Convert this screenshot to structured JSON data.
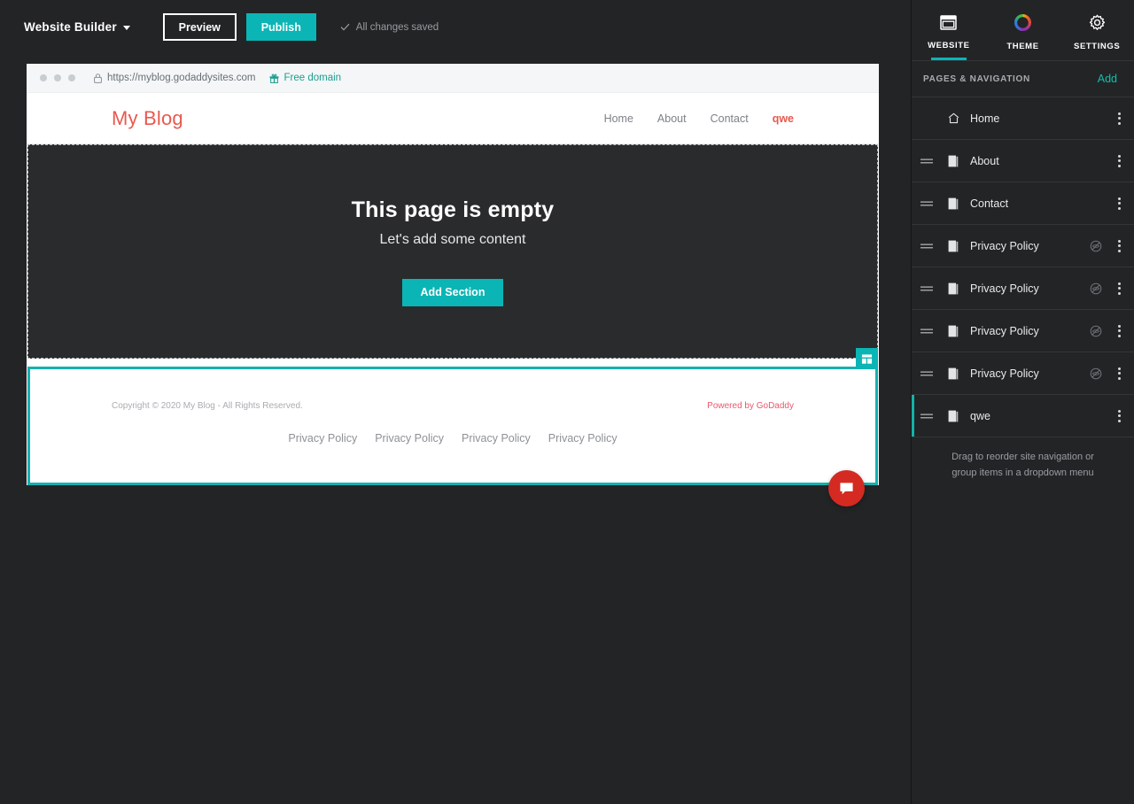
{
  "topbar": {
    "brand": "Website Builder",
    "preview_label": "Preview",
    "publish_label": "Publish",
    "saved_label": "All changes saved",
    "caret_icon": "chevron-down-icon",
    "check_icon": "check-icon"
  },
  "browser": {
    "url": "https://myblog.godaddysites.com",
    "free_domain_label": "Free domain",
    "lock_icon": "lock-icon",
    "gift_icon": "gift-icon"
  },
  "site": {
    "logo": "My Blog",
    "nav": [
      {
        "label": "Home",
        "active": false
      },
      {
        "label": "About",
        "active": false
      },
      {
        "label": "Contact",
        "active": false
      },
      {
        "label": "qwe",
        "active": true
      }
    ],
    "empty": {
      "title": "This page is empty",
      "subtitle": "Let's add some content",
      "add_section_label": "Add Section"
    },
    "footer": {
      "copyright": "Copyright © 2020 My Blog - All Rights Reserved.",
      "powered_prefix": "Powered by ",
      "powered_brand": "GoDaddy",
      "links": [
        "Privacy Policy",
        "Privacy Policy",
        "Privacy Policy",
        "Privacy Policy"
      ],
      "section_badge_icon": "section-layout-icon",
      "chat_icon": "chat-bubble-icon"
    }
  },
  "sidebar": {
    "tabs": [
      {
        "label": "WEBSITE",
        "icon": "browser-window-icon",
        "active": true
      },
      {
        "label": "THEME",
        "icon": "color-wheel-icon",
        "active": false
      },
      {
        "label": "SETTINGS",
        "icon": "gear-icon",
        "active": false
      }
    ],
    "pages_header": {
      "title": "PAGES & NAVIGATION",
      "add_label": "Add"
    },
    "pages": [
      {
        "label": "Home",
        "icon": "home-icon",
        "draggable": false,
        "hidden": false,
        "selected": false
      },
      {
        "label": "About",
        "icon": "page-icon",
        "draggable": true,
        "hidden": false,
        "selected": false
      },
      {
        "label": "Contact",
        "icon": "page-icon",
        "draggable": true,
        "hidden": false,
        "selected": false
      },
      {
        "label": "Privacy Policy",
        "icon": "page-icon",
        "draggable": true,
        "hidden": true,
        "selected": false
      },
      {
        "label": "Privacy Policy",
        "icon": "page-icon",
        "draggable": true,
        "hidden": true,
        "selected": false
      },
      {
        "label": "Privacy Policy",
        "icon": "page-icon",
        "draggable": true,
        "hidden": true,
        "selected": false
      },
      {
        "label": "Privacy Policy",
        "icon": "page-icon",
        "draggable": true,
        "hidden": true,
        "selected": false
      },
      {
        "label": "qwe",
        "icon": "page-icon",
        "draggable": true,
        "hidden": false,
        "selected": true
      }
    ],
    "hint": "Drag to reorder site navigation or group items in a dropdown menu"
  },
  "colors": {
    "teal": "#0bb5b5",
    "teal_select": "#16b0b0",
    "red_logo": "#e8594f",
    "red_chat": "#d42a21",
    "green_link": "#1a9e8f",
    "dark_bg": "#232426",
    "section_dark": "#2a2b2d"
  }
}
